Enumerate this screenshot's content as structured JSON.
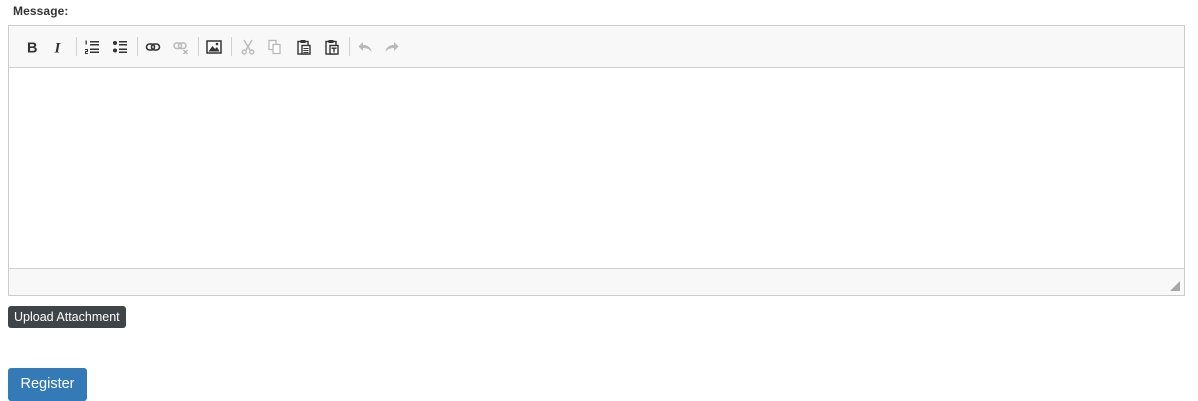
{
  "form": {
    "message_label": "Message:",
    "upload_label": "Upload Attachment",
    "register_label": "Register"
  },
  "editor": {
    "content": "",
    "toolbar": [
      {
        "name": "bold-icon",
        "glyph": "B",
        "enabled": true
      },
      {
        "name": "italic-icon",
        "glyph": "I",
        "enabled": true
      },
      {
        "name": "numbered-list-icon",
        "enabled": true
      },
      {
        "name": "bulleted-list-icon",
        "enabled": true
      },
      {
        "name": "link-icon",
        "enabled": true
      },
      {
        "name": "unlink-icon",
        "enabled": false
      },
      {
        "name": "image-icon",
        "enabled": true
      },
      {
        "name": "cut-icon",
        "enabled": false
      },
      {
        "name": "copy-icon",
        "enabled": false
      },
      {
        "name": "paste-icon",
        "enabled": true
      },
      {
        "name": "paste-text-icon",
        "enabled": true
      },
      {
        "name": "undo-icon",
        "enabled": false
      },
      {
        "name": "redo-icon",
        "enabled": false
      }
    ]
  },
  "colors": {
    "primary": "#337ab7",
    "dark_button": "#3f4448",
    "toolbar_bg": "#f8f8f8",
    "icon_enabled": "#333333",
    "icon_disabled": "#b9b9b9"
  }
}
